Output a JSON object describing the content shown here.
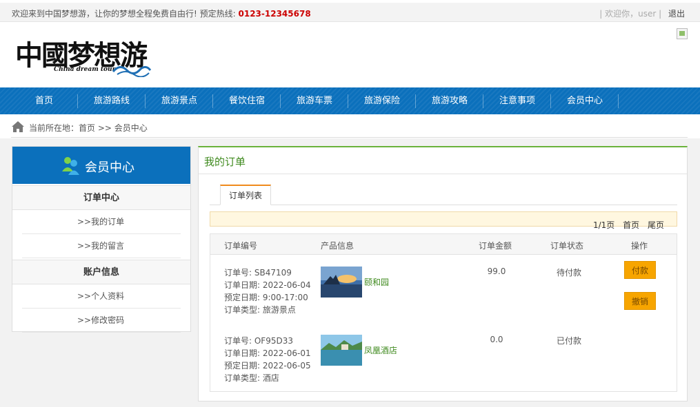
{
  "topbar": {
    "welcome": "欢迎来到中国梦想游，让你的梦想全程免费自由行!   预定热线:",
    "hotline": "0123-12345678",
    "greeting": "| 欢迎你，user |",
    "logout": "退出"
  },
  "logo": {
    "cn": "中國梦想游",
    "en": "China dream tour"
  },
  "nav": [
    "首页",
    "旅游路线",
    "旅游景点",
    "餐饮住宿",
    "旅游车票",
    "旅游保险",
    "旅游攻略",
    "注意事项",
    "会员中心"
  ],
  "breadcrumb": "当前所在地：首页 >> 会员中心",
  "sidebar": {
    "title": "会员中心",
    "sections": [
      {
        "title": "订单中心",
        "links": [
          ">>我的订单",
          ">>我的留言"
        ]
      },
      {
        "title": "账户信息",
        "links": [
          ">>个人资料",
          ">>修改密码"
        ]
      }
    ]
  },
  "main": {
    "title": "我的订单",
    "tab": "订单列表",
    "pager": {
      "page": "1/1页",
      "first": "首页",
      "last": "尾页"
    },
    "columns": [
      "订单编号",
      "产品信息",
      "订单金额",
      "订单状态",
      "操作"
    ],
    "orders": [
      {
        "no": "订单号:  SB47109",
        "date": "订单日期:  2022-06-04",
        "reserve": "预定日期:  9:00-17:00",
        "type": "订单类型:  旅游景点",
        "product": "颐和园",
        "amount": "99.0",
        "status": "待付款",
        "actions": [
          "付款",
          "撤销"
        ]
      },
      {
        "no": "订单号:  OF95D33",
        "date": "订单日期:  2022-06-01",
        "reserve": "预定日期:  2022-06-05",
        "type": "订单类型:  酒店",
        "product": "凤凰酒店",
        "amount": "0.0",
        "status": "已付款",
        "actions": []
      }
    ]
  },
  "colors": {
    "nav_blue": "#0b70bc",
    "accent_green": "#6ab23a",
    "button_orange": "#f7a500",
    "hotline_red": "#cc0000"
  }
}
